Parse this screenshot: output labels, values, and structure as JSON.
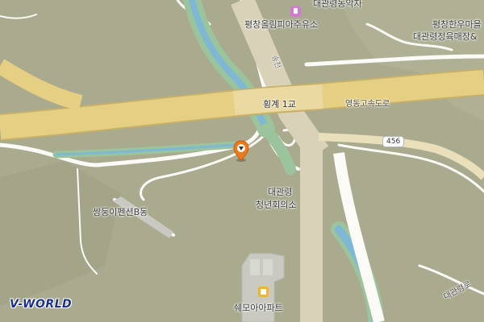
{
  "map": {
    "provider_logo": "V-WORLD",
    "colors": {
      "terrain": "#a9aa8e",
      "highway": "#e5cf83",
      "local_road": "#fbfaf7",
      "river": "#7fb8d4",
      "riverbank": "#9cc49c",
      "building": "#c9c9c2"
    },
    "labels": {
      "top_partial": "대관령농악자",
      "gas_station": "평창올림피아주유소",
      "meat_shop_line1": "평창한우마을",
      "meat_shop_line2": "대관령정육매장&",
      "bridge": "횡계 1교",
      "expressway": "영동고속도로",
      "route_number": "456",
      "youth_hall_line1": "대관령",
      "youth_hall_line2": "청년회의소",
      "pension": "쌍둥이펜션B동",
      "apartment": "쉐모아아파트",
      "stream": "송천",
      "road_bottom_right": "대관령로"
    },
    "markers": [
      {
        "name": "selected-location",
        "icon": "location-pin-icon",
        "color": "#f07a1a"
      }
    ],
    "icons": {
      "gas_station": "gas-station-icon",
      "apartment": "apartment-icon"
    }
  }
}
